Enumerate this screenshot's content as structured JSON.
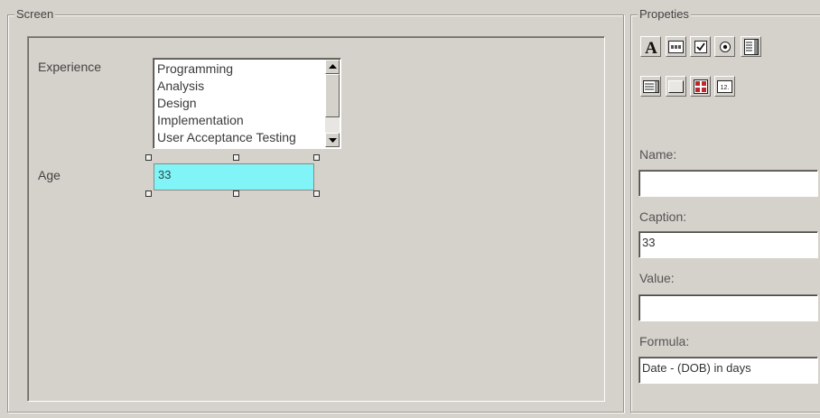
{
  "screen_group": {
    "title": "Screen",
    "fields": [
      {
        "label": "Experience"
      },
      {
        "label": "Age"
      }
    ],
    "experience_list": {
      "items": [
        "Programming",
        "Analysis",
        "Design",
        "Implementation",
        "User Acceptance Testing"
      ]
    },
    "age_field": {
      "value": "33"
    }
  },
  "properties_group": {
    "title": "Propeties",
    "tools": [
      {
        "icon": "text-label-icon"
      },
      {
        "icon": "textbox-icon"
      },
      {
        "icon": "checkbox-icon"
      },
      {
        "icon": "radio-button-icon"
      },
      {
        "icon": "listbox-icon"
      },
      {
        "icon": "combobox-icon"
      },
      {
        "icon": "button-icon"
      },
      {
        "icon": "grid-icon"
      },
      {
        "icon": "numeric-field-icon"
      }
    ],
    "name": {
      "label": "Name:",
      "value": ""
    },
    "caption": {
      "label": "Caption:",
      "value": "33"
    },
    "value": {
      "label": "Value:",
      "value": ""
    },
    "formula": {
      "label": "Formula:",
      "value": "Date - (DOB) in days"
    }
  },
  "colors": {
    "background": "#d5d1cb",
    "selected_field": "#80f4f6"
  }
}
